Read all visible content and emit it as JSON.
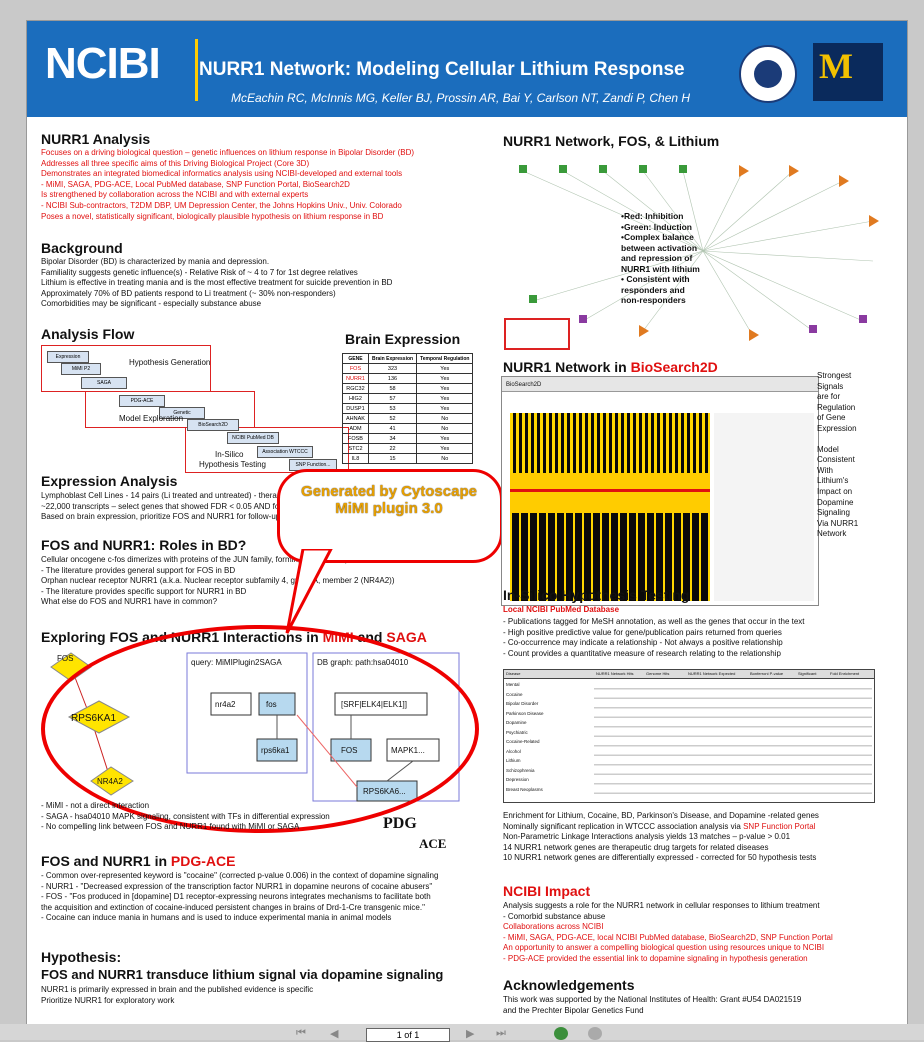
{
  "banner": {
    "logo": "NCIBI",
    "title": "NURR1 Network: Modeling Cellular Lithium Response",
    "authors": "McEachin RC, McInnis MG, Keller BJ, Prossin AR, Bai Y, Carlson NT, Zandi P, Chen H",
    "um_logo": "M"
  },
  "nurr1_analysis": {
    "heading": "NURR1 Analysis",
    "lines": [
      "Focuses on a driving biological question – genetic influences on lithium response in Bipolar Disorder (BD)",
      "Addresses all three specific aims of this Driving Biological Project (Core 3D)",
      "Demonstrates an integrated biomedical informatics analysis using NCIBI-developed and external tools",
      " - MiMI, SAGA, PDG-ACE, Local PubMed database, SNP Function Portal, BioSearch2D",
      "Is strengthened by collaboration across the NCIBI and with external experts",
      " - NCIBI Sub-contractors, T2DM DBP, UM Depression Center, the Johns Hopkins Univ., Univ. Colorado",
      "Poses a novel, statistically significant, biologically plausible hypothesis on lithium response in BD"
    ]
  },
  "background": {
    "heading": "Background",
    "lines": [
      "Bipolar Disorder (BD) is characterized by mania and depression.",
      "Familiality suggests genetic influence(s) - Relative Risk of ~ 4 to 7 for 1st degree relatives",
      "Lithium is effective in treating mania and is the most effective treatment for suicide prevention in BD",
      "Approximately 70% of BD patients respond to Li treatment (~ 30% non-responders)",
      "Comorbidities may be significant - especially substance abuse"
    ]
  },
  "analysis_flow": {
    "heading": "Analysis Flow",
    "labels": [
      "Hypothesis Generation",
      "Model Exploration",
      "In-Silico",
      "Hypothesis Testing"
    ],
    "steps": [
      "Expression",
      "MiMI P2",
      "SAGA",
      "PDG-ACE",
      "Genetic",
      "BioSearch2D",
      "NCIBI PubMed DB",
      "Association WTCCC",
      "SNP Function..."
    ]
  },
  "brain_expression": {
    "heading": "Brain Expression",
    "columns": [
      "GENE",
      "Brain Expression",
      "Temporal Regulation"
    ],
    "rows": [
      [
        "FOS",
        "323",
        "Yes"
      ],
      [
        "NURR1",
        "136",
        "Yes"
      ],
      [
        "RGC32",
        "58",
        "Yes"
      ],
      [
        "HIG2",
        "57",
        "Yes"
      ],
      [
        "DUSP1",
        "53",
        "Yes"
      ],
      [
        "AHNAK",
        "52",
        "No"
      ],
      [
        "ADM",
        "41",
        "No"
      ],
      [
        "FOSB",
        "34",
        "Yes"
      ],
      [
        "STC2",
        "22",
        "Yes"
      ],
      [
        "IL8",
        "15",
        "No"
      ]
    ]
  },
  "expression_analysis": {
    "heading": "Expression Analysis",
    "lines": [
      "Lymphoblast Cell Lines - 14 pairs (Li treated and untreated) - therapeutic exposure",
      "~22,000 transcripts – select genes that showed FDR < 0.05 AND fold change > +/- 30%",
      "Based on brain expression,  prioritize FOS and NURR1 for follow-up"
    ]
  },
  "fos_roles": {
    "heading": "FOS and NURR1: Roles in BD?",
    "lines": [
      "Cellular oncogene c-fos dimerizes with proteins of the JUN family, forming the TF complex AP-1",
      " - The literature provides general support for FOS in BD",
      "Orphan nuclear receptor NURR1 (a.k.a. Nuclear receptor subfamily 4, group A, member 2 (NR4A2))",
      " - The literature provides specific support for NURR1 in BD",
      "What else do FOS and NURR1 have in common?"
    ]
  },
  "exploring": {
    "heading_pre": "Exploring FOS and NURR1 Interactions in ",
    "mimi": "MiMI",
    "and": " and ",
    "saga": "SAGA",
    "nodes": [
      "FOS",
      "RPS6KA1",
      "NR4A2"
    ],
    "query_title": "query: MiMIPlugin2SAGA",
    "db_title": "DB graph: path:hsa04010",
    "query_nodes": [
      "nr4a2",
      "fos",
      "rps6ka1"
    ],
    "db_nodes": [
      "[SRF|ELK4|ELK1]]",
      "FOS",
      "MAPK1...",
      "RPS6KA6..."
    ],
    "lines": [
      "- MiMI - not a direct interaction",
      "- SAGA - hsa04010 MAPK signaling, consistent with TFs in differential expression",
      "- No compelling link between FOS and NURR1 found with MiMI or SAGA"
    ],
    "pdg_logo": "PDG",
    "ace_logo": "ACE"
  },
  "callout": {
    "text": "Generated by Cytoscape MiMI plugin 3.0"
  },
  "pdg_ace": {
    "heading_pre": "FOS and NURR1 in ",
    "heading_red": "PDG-ACE",
    "lines": [
      "- Common over-represented keyword is \"cocaine\" (corrected p-value 0.006) in the context of dopamine signaling",
      "- NURR1 - \"Decreased expression of the transcription factor NURR1 in dopamine neurons of cocaine abusers\"",
      "- FOS - \"Fos produced in [dopamine] D1 receptor-expressing neurons integrates mechanisms to facilitate both",
      "  the acquisition and extinction of cocaine-induced persistent changes in brains of Drd-1-Cre transgenic mice.\"",
      "- Cocaine can induce mania in humans and is used to induce experimental mania in animal models"
    ]
  },
  "hypothesis": {
    "heading": "Hypothesis:",
    "subheading": "FOS and NURR1 transduce lithium signal via dopamine signaling",
    "lines": [
      "NURR1 is primarily expressed in brain and the published evidence is specific",
      "Prioritize NURR1 for exploratory work"
    ]
  },
  "network": {
    "heading": "NURR1 Network, FOS, & Lithium",
    "legend": [
      "•Red: Inhibition",
      "•Green: Induction",
      "•Complex balance",
      "between activation",
      "and repression of",
      "NURR1 with lithium",
      "• Consistent with",
      "responders and",
      "non-responders"
    ]
  },
  "biosearch": {
    "heading_pre": "NURR1 Network in ",
    "heading_red": "BioSearch2D",
    "app_name": "BioSearch2D",
    "notes": [
      "Strongest",
      "Signals",
      "are for",
      "Regulation",
      "of Gene",
      "Expression",
      "",
      "Model",
      "Consistent",
      "With",
      "Lithium's",
      "Impact on",
      "Dopamine",
      "Signaling",
      "Via NURR1",
      "Network"
    ]
  },
  "insilico": {
    "heading": "In-Silico Hypothesis Testing",
    "subheading": "Local NCIBI PubMed Database",
    "lines": [
      "- Publications tagged for MeSH annotation, as well as the genes that occur in the text",
      "- High positive predictive value for gene/publication pairs returned from queries",
      "- Co-occurrence may indicate a relationship - Not always a positive relationship",
      "- Count provides a quantitative measure of research relating to the relationship"
    ],
    "table_header": [
      "Disease",
      "NURR1 Network Hits",
      "Genome Hits",
      "NURR1 Network Expected",
      "Bonferroni P-value",
      "Significant",
      "Fold Enrichment"
    ],
    "table_rows": [
      "Mental",
      "Cocaine",
      "Bipolar Disorder",
      "Parkinson Disease",
      "Dopamine",
      "Psychiatric",
      "Cocaine-Related",
      "Alcohol",
      "Lithium",
      "Schizophrenia",
      "Depression",
      "Breast Neoplasms"
    ],
    "after_lines": [
      "Enrichment for Lithium, Cocaine, BD, Parkinson's Disease, and Dopamine -related genes",
      "Nominally significant replication in WTCCC association analysis via ",
      "Non-Parametric Linkage Interactions analysis yields 13 matches – p-value > 0.01",
      "14 NURR1 network genes are therapeutic drug targets for related diseases",
      "10 NURR1 network genes are differentially expressed - corrected for 50 hypothesis tests"
    ],
    "snp_link": "SNP Function Portal"
  },
  "impact": {
    "heading": "NCIBI Impact",
    "lines": [
      "Analysis suggests a role for the NURR1 network in cellular responses to lithium treatment",
      " - Comorbid substance abuse",
      "Collaborations across NCIBI",
      " - MiMI, SAGA, PDG-ACE, local NCIBI PubMed database, BioSearch2D, SNP Function Portal",
      "An opportunity to answer a compelling biological question using resources unique to NCIBI",
      " - PDG-ACE provided the essential link to dopamine signaling in hypothesis generation"
    ]
  },
  "ack": {
    "heading": "Acknowledgements",
    "lines": [
      "This work was supported by the National Institutes of Health: Grant #U54 DA021519",
      "and the Prechter Bipolar Genetics Fund"
    ]
  },
  "viewer": {
    "page_indicator": "1 of 1"
  }
}
